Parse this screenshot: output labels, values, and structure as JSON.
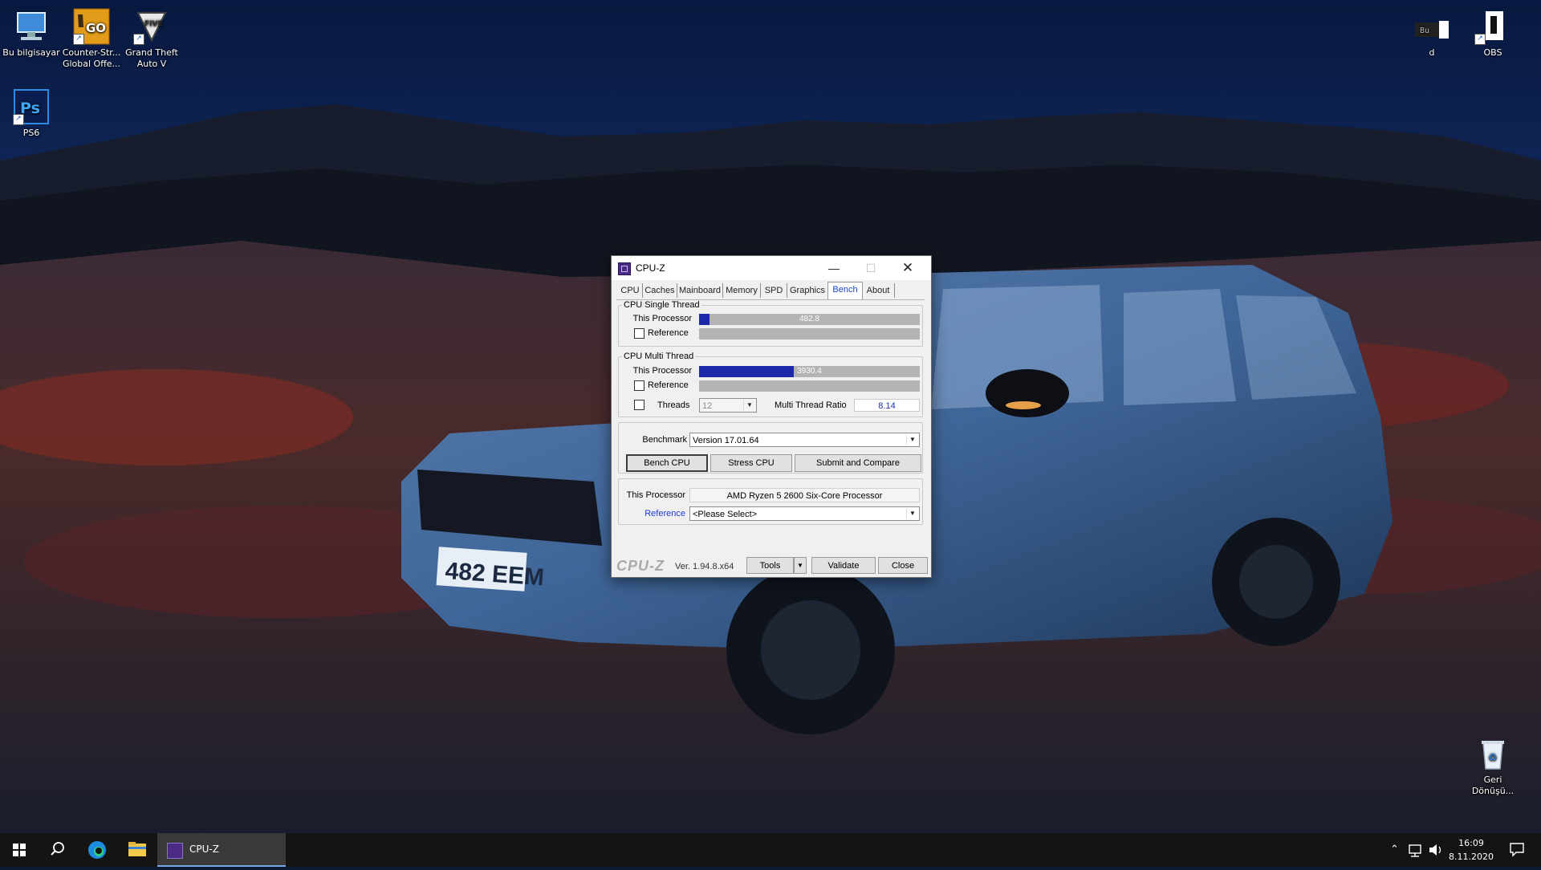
{
  "desktop": {
    "icons": [
      {
        "label": "Bu bilgisayar",
        "icon": "computer-icon"
      },
      {
        "label": "Counter-Str... Global Offe...",
        "icon": "csgo-icon"
      },
      {
        "label": "Grand Theft Auto V",
        "icon": "gta-v-icon"
      },
      {
        "label": "PS6",
        "icon": "photoshop-icon"
      },
      {
        "label": "d",
        "icon": "folder-icon"
      },
      {
        "label": "OBS",
        "icon": "obs-icon"
      },
      {
        "label": "Geri Dönüşü...",
        "icon": "recycle-bin-icon"
      }
    ]
  },
  "window": {
    "title": "CPU-Z",
    "tabs": [
      "CPU",
      "Caches",
      "Mainboard",
      "Memory",
      "SPD",
      "Graphics",
      "Bench",
      "About"
    ],
    "active_tab": "Bench",
    "single_thread": {
      "legend": "CPU Single Thread",
      "this_label": "This Processor",
      "this_value": "482.8",
      "this_fraction": 0.047,
      "ref_label": "Reference"
    },
    "multi_thread": {
      "legend": "CPU Multi Thread",
      "this_label": "This Processor",
      "this_value": "3930.4",
      "this_fraction": 0.43,
      "ref_label": "Reference",
      "threads_label": "Threads",
      "threads_value": "12",
      "ratio_label": "Multi Thread Ratio",
      "ratio_value": "8.14"
    },
    "benchmark": {
      "label": "Benchmark",
      "version": "Version 17.01.64",
      "bench_cpu": "Bench CPU",
      "stress_cpu": "Stress CPU",
      "submit": "Submit and Compare"
    },
    "processor": {
      "this_label": "This Processor",
      "this_value": "AMD Ryzen 5 2600 Six-Core Processor",
      "ref_label": "Reference",
      "ref_value": "<Please Select>"
    },
    "footer": {
      "brand": "CPU-Z",
      "version": "Ver. 1.94.8.x64",
      "tools": "Tools",
      "validate": "Validate",
      "close": "Close"
    }
  },
  "taskbar": {
    "task_label": "CPU-Z",
    "time": "16:09",
    "date": "8.11.2020"
  },
  "colors": {
    "bench_fill": "#1d28a8",
    "active_tab": "#1a3fd6",
    "taskbar": "#141414"
  }
}
